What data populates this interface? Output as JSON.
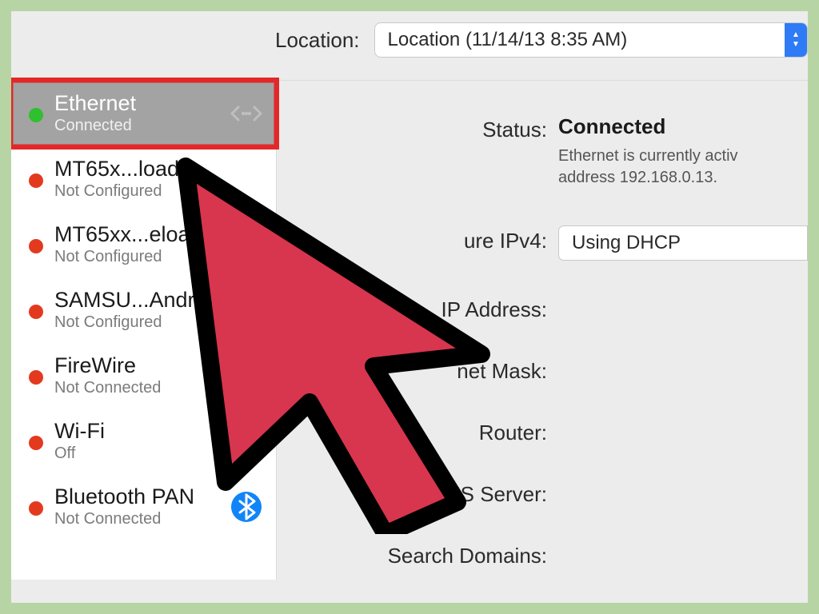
{
  "location": {
    "label": "Location:",
    "value": "Location (11/14/13 8:35 AM)"
  },
  "sidebar": {
    "items": [
      {
        "name": "Ethernet",
        "status": "Connected",
        "dot": "green",
        "icon": "ethernet",
        "selected": true
      },
      {
        "name": "MT65x...load",
        "status": "Not Configured",
        "dot": "red",
        "icon": "phone"
      },
      {
        "name": "MT65xx...eload",
        "status": "Not Configured",
        "dot": "red",
        "icon": "phone"
      },
      {
        "name": "SAMSU...Android",
        "status": "Not Configured",
        "dot": "red",
        "icon": "phone"
      },
      {
        "name": "FireWire",
        "status": "Not Connected",
        "dot": "red",
        "icon": "firewire"
      },
      {
        "name": "Wi-Fi",
        "status": "Off",
        "dot": "red",
        "icon": "wifi"
      },
      {
        "name": "Bluetooth PAN",
        "status": "Not Connected",
        "dot": "red",
        "icon": "bluetooth"
      }
    ]
  },
  "detail": {
    "status_label": "Status:",
    "status_value": "Connected",
    "status_sub_line1": "Ethernet is currently activ",
    "status_sub_line2": "address 192.168.0.13.",
    "configure_ipv4_label": "ure IPv4:",
    "configure_ipv4_value": "Using DHCP",
    "ip_address_label": "IP Address:",
    "subnet_mask_label": "net Mask:",
    "router_label": "Router:",
    "dns_server_label": "DNS Server:",
    "search_domains_label": "Search Domains:"
  },
  "colors": {
    "highlight": "#e22828"
  }
}
